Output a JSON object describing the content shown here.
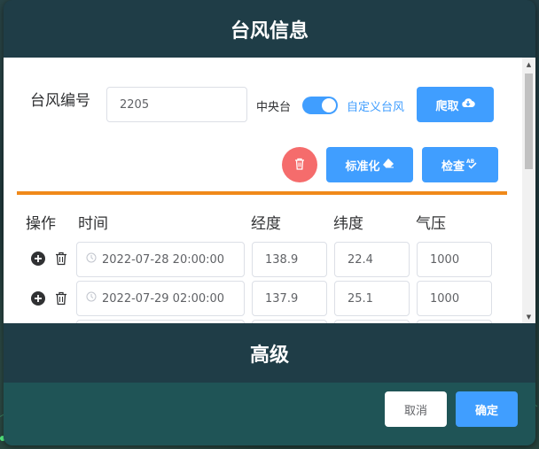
{
  "dialog": {
    "title": "台风信息",
    "advanced_label": "高级"
  },
  "form": {
    "typhoon_id_label": "台风编号",
    "typhoon_id_value": "2205",
    "source_label": "中央台",
    "source_switch_on": true,
    "custom_label": "自定义台风",
    "crawl_button": "爬取",
    "standardize_button": "标准化",
    "check_button": "检查"
  },
  "table": {
    "headers": {
      "action": "操作",
      "time": "时间",
      "lon": "经度",
      "lat": "纬度",
      "pressure": "气压"
    },
    "rows": [
      {
        "time": "2022-07-28 20:00:00",
        "lon": "138.9",
        "lat": "22.4",
        "pressure": "1000"
      },
      {
        "time": "2022-07-29 02:00:00",
        "lon": "137.9",
        "lat": "25.1",
        "pressure": "1000"
      }
    ]
  },
  "footer": {
    "cancel_button": "取消",
    "confirm_button": "确定"
  },
  "colors": {
    "primary": "#409eff",
    "danger": "#f56c6c",
    "divider": "#f0891a"
  }
}
